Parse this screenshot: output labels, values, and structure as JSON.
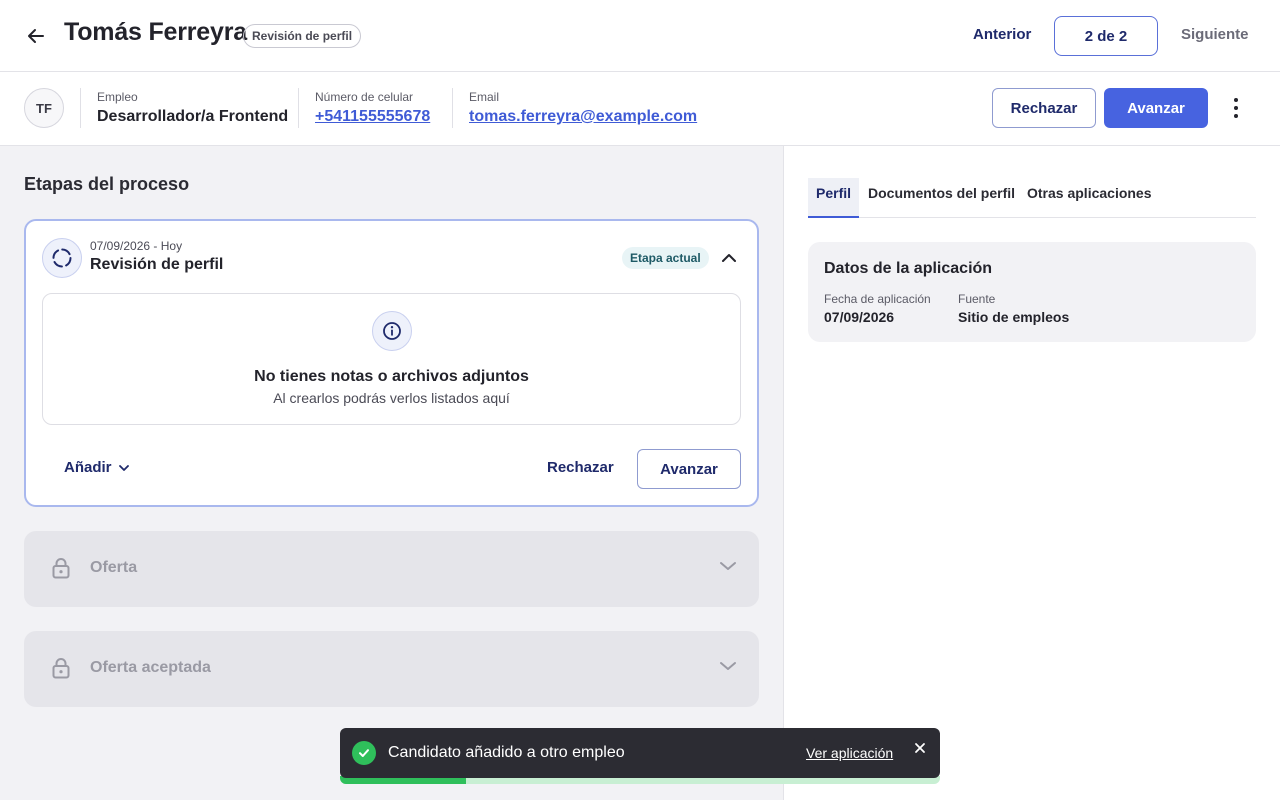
{
  "header": {
    "candidate_name": "Tomás Ferreyra",
    "status_chip": "Revisión de perfil",
    "prev_label": "Anterior",
    "count_label": "2 de 2",
    "next_label": "Siguiente"
  },
  "info": {
    "avatar_initials": "TF",
    "job_label": "Empleo",
    "job_value": "Desarrollador/a Frontend",
    "phone_label": "Número de celular",
    "phone_value": "+541155555678",
    "email_label": "Email",
    "email_value": "tomas.ferreyra@example.com",
    "reject_label": "Rechazar",
    "advance_label": "Avanzar"
  },
  "process": {
    "title": "Etapas del proceso",
    "current_stage": {
      "date": "07/09/2026 - Hoy",
      "name": "Revisión de perfil",
      "badge": "Etapa actual",
      "empty_title": "No tienes notas o archivos adjuntos",
      "empty_subtitle": "Al crearlos podrás verlos listados aquí",
      "add_label": "Añadir",
      "reject_label": "Rechazar",
      "advance_label": "Avanzar"
    },
    "locked_stages": [
      {
        "name": "Oferta"
      },
      {
        "name": "Oferta aceptada"
      }
    ]
  },
  "right": {
    "tabs": [
      {
        "label": "Perfil",
        "active": true
      },
      {
        "label": "Documentos del perfil",
        "active": false
      },
      {
        "label": "Otras aplicaciones",
        "active": false
      }
    ],
    "application": {
      "title": "Datos de la aplicación",
      "date_label": "Fecha de aplicación",
      "date_value": "07/09/2026",
      "source_label": "Fuente",
      "source_value": "Sitio de empleos"
    }
  },
  "toast": {
    "message": "Candidato añadido a otro empleo",
    "link_label": "Ver aplicación",
    "progress_fraction": 0.21
  },
  "colors": {
    "primary": "#4763e0",
    "navy": "#1f2a6b",
    "success": "#2fbf5b",
    "toast_bg": "#2c2c33",
    "panel_bg": "#f2f2f5"
  }
}
